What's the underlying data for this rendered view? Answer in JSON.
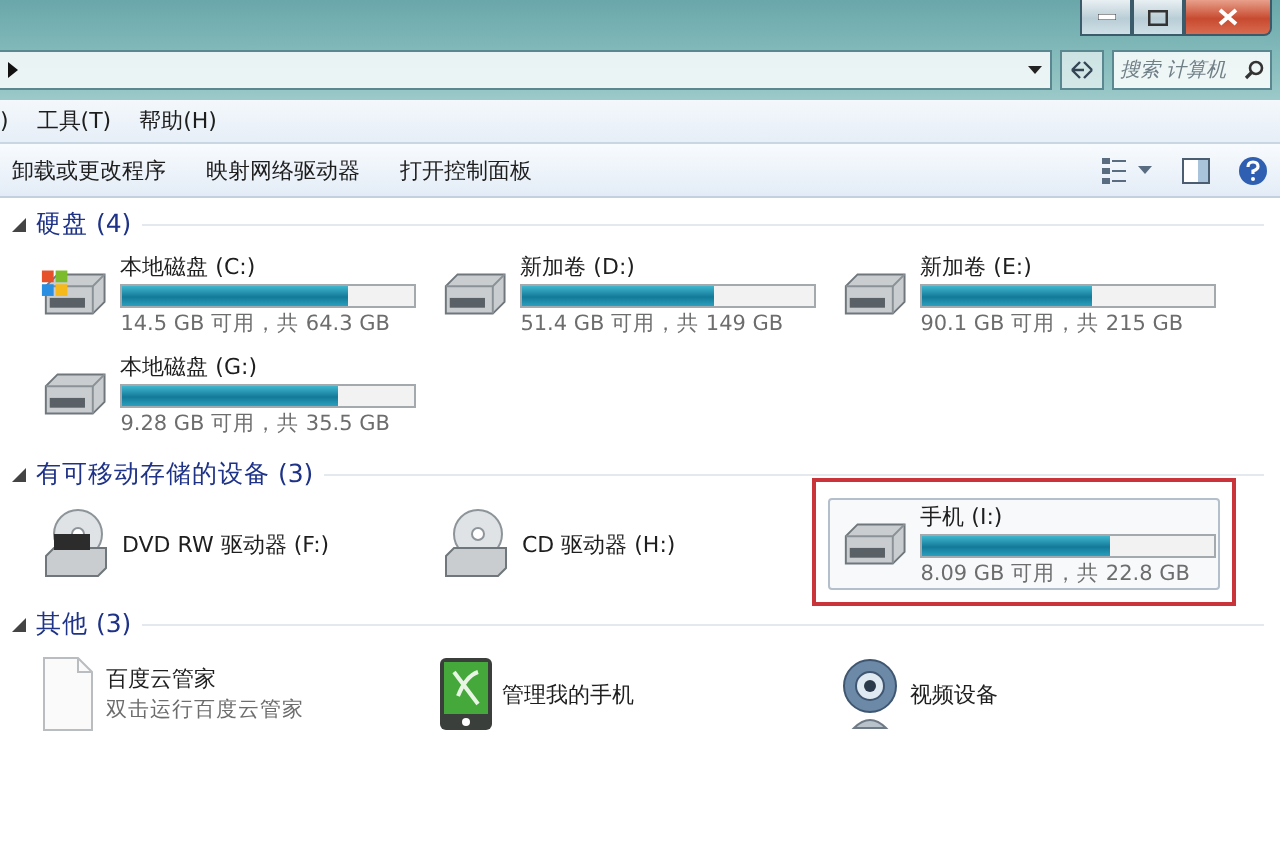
{
  "address_bar": {
    "search_placeholder": "搜索 计算机"
  },
  "menu": [
    ")",
    "工具(T)",
    "帮助(H)"
  ],
  "toolbar": [
    "卸载或更改程序",
    "映射网络驱动器",
    "打开控制面板"
  ],
  "sections": [
    {
      "title": "硬盘 (4)",
      "expanded": true,
      "items": [
        {
          "kind": "system-drive",
          "name": "本地磁盘 (C:)",
          "detail": "14.5 GB 可用，共 64.3 GB",
          "level": 0.77,
          "selected": false,
          "highlighted": false
        },
        {
          "kind": "drive",
          "name": "新加卷 (D:)",
          "detail": "51.4 GB 可用，共 149 GB",
          "level": 0.655,
          "selected": false,
          "highlighted": false
        },
        {
          "kind": "drive",
          "name": "新加卷 (E:)",
          "detail": "90.1 GB 可用，共 215 GB",
          "level": 0.58,
          "selected": false,
          "highlighted": false
        },
        {
          "kind": "drive",
          "name": "本地磁盘 (G:)",
          "detail": "9.28 GB 可用，共 35.5 GB",
          "level": 0.74,
          "selected": false,
          "highlighted": false
        }
      ]
    },
    {
      "title": "有可移动存储的设备 (3)",
      "expanded": true,
      "items": [
        {
          "kind": "dvd",
          "name": "DVD RW 驱动器 (F:)",
          "selected": false,
          "highlighted": false
        },
        {
          "kind": "cd",
          "name": "CD 驱动器 (H:)",
          "selected": false,
          "highlighted": false
        },
        {
          "kind": "drive",
          "name": "手机 (I:)",
          "detail": "8.09 GB 可用，共 22.8 GB",
          "level": 0.645,
          "selected": true,
          "highlighted": true
        }
      ]
    },
    {
      "title": "其他 (3)",
      "expanded": true,
      "items": [
        {
          "kind": "file",
          "name": "百度云管家",
          "detail": "双击运行百度云管家",
          "selected": false,
          "highlighted": false
        },
        {
          "kind": "phone-app",
          "name": "管理我的手机",
          "selected": false,
          "highlighted": false
        },
        {
          "kind": "webcam",
          "name": "视频设备",
          "selected": false,
          "highlighted": false
        }
      ]
    }
  ]
}
